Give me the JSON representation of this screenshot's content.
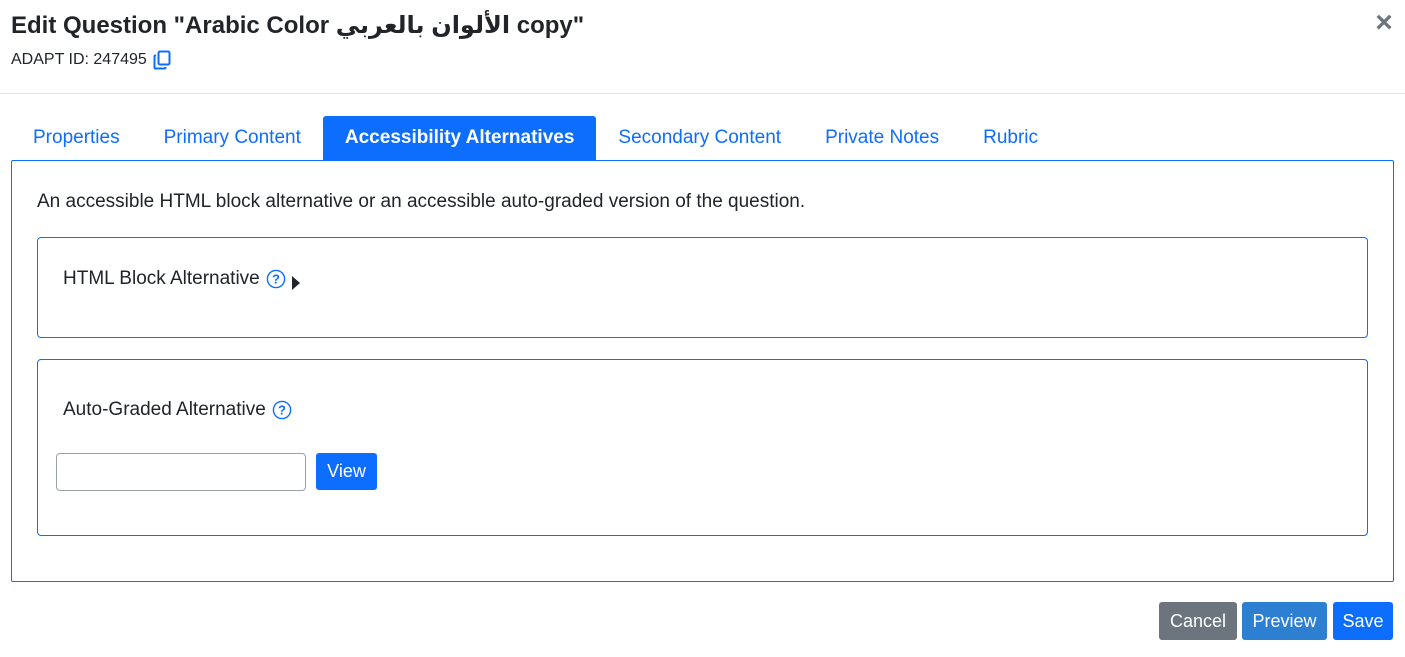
{
  "modal": {
    "title": "Edit Question \"Arabic Color الألوان بالعربي copy\"",
    "adapt_id_text": "ADAPT ID: 247495",
    "close_symbol": "×"
  },
  "tabs": [
    {
      "label": "Properties",
      "active": false
    },
    {
      "label": "Primary Content",
      "active": false
    },
    {
      "label": "Accessibility Alternatives",
      "active": true
    },
    {
      "label": "Secondary Content",
      "active": false
    },
    {
      "label": "Private Notes",
      "active": false
    },
    {
      "label": "Rubric",
      "active": false
    }
  ],
  "panel": {
    "intro": "An accessible HTML block alternative or an accessible auto-graded version of the question.",
    "html_block": {
      "label": "HTML Block Alternative",
      "help_icon": "question-circle-icon",
      "toggle_icon": "caret-right-icon"
    },
    "auto_graded": {
      "label": "Auto-Graded Alternative",
      "help_icon": "question-circle-icon",
      "input_value": "",
      "view_label": "View"
    }
  },
  "footer": {
    "cancel_label": "Cancel",
    "preview_label": "Preview",
    "save_label": "Save"
  },
  "colors": {
    "primary": "#0d6efd",
    "secondary": "#6c757d",
    "preview": "#2c7fd1",
    "text": "#212529"
  },
  "icons": {
    "copy": "copy-icon",
    "close": "close-icon"
  }
}
